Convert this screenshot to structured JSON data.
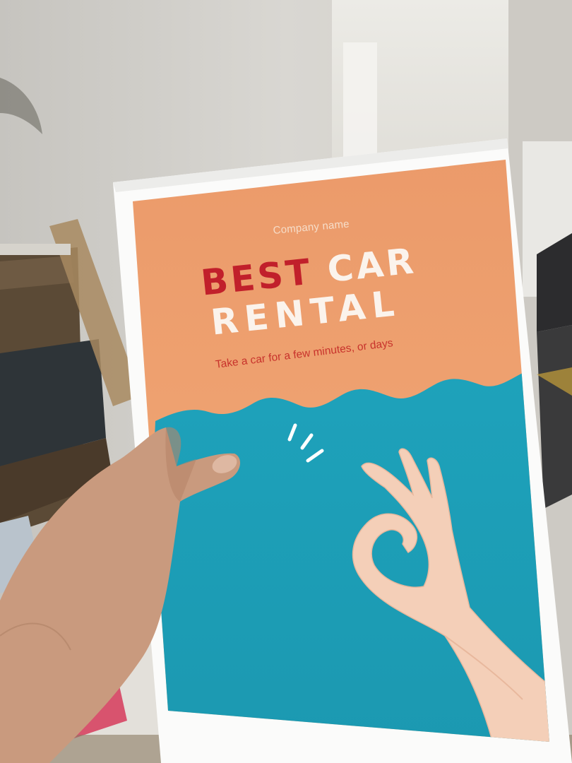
{
  "poster": {
    "company_name": "Company name",
    "title_word_1": "BEST",
    "title_word_2": "CAR",
    "title_line_2": "RENTAL",
    "tagline": "Take a car for a few minutes, or days"
  },
  "colors": {
    "poster_orange": "#eea06d",
    "poster_teal": "#1f9db5",
    "title_red": "#c1202b",
    "title_white": "#fbf3ec",
    "hand_skin": "#f3cdb6",
    "wall": "#d8d6d1"
  }
}
